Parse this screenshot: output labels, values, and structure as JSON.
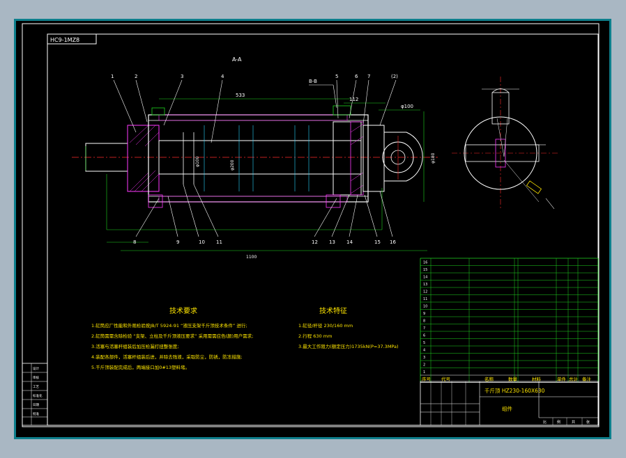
{
  "drawing": {
    "corner_code": "HC9-1MZ8",
    "section_label": "A-A",
    "detail_label": "B-B",
    "part_numbers_top": [
      "1",
      "2",
      "3",
      "4",
      "5",
      "6",
      "7",
      "(2)"
    ],
    "part_numbers_bottom": [
      "8",
      "9",
      "10",
      "11",
      "12",
      "13",
      "14",
      "15",
      "16"
    ],
    "dimensions": {
      "d100": "φ100",
      "d180": "φ180",
      "d112": "112",
      "d533": "533",
      "dia200": "φ200",
      "overall": "1100",
      "d_top": "φ100"
    }
  },
  "tech_requirements": {
    "title": "技术要求",
    "items": [
      "1.缸筒应厂性能和外观检验按JB/T 5924-91 “液压支架千斤顶技术条件” 进行;",
      "2.缸筒需需含除检验 “支架、立柱及千斤顶液压要求” 采用需需应色(颜)用户需求;",
      "3.活塞与活塞杆组装后加压检漏打扭整张度;",
      "4.装配各部件，活塞杆组装后进，并除去残液，采取防尘，防锈，防冻措施;",
      "5.千斤顶装配完成后，两端接口加0#13塑料堵。"
    ]
  },
  "tech_features": {
    "title": "技术特征",
    "items": [
      "1.缸径/杆径  230/160 mm",
      "2.行程        630 mm",
      "3.最大工作阻力(额定压力)1735kN(P=37.3MPa)"
    ]
  },
  "parts_table": {
    "header": [
      "序号",
      "代号",
      "名称",
      "数量",
      "材料",
      "单件",
      "总计",
      "备注"
    ],
    "rows": [
      [
        "16",
        "",
        "",
        "",
        "",
        "",
        "",
        ""
      ],
      [
        "15",
        "",
        "",
        "",
        "",
        "",
        "",
        ""
      ],
      [
        "14",
        "",
        "",
        "",
        "",
        "",
        "",
        ""
      ],
      [
        "13",
        "",
        "",
        "",
        "",
        "",
        "",
        ""
      ],
      [
        "12",
        "",
        "",
        "",
        "",
        "",
        "",
        ""
      ],
      [
        "11",
        "",
        "",
        "",
        "",
        "",
        "",
        ""
      ],
      [
        "10",
        "",
        "",
        "",
        "",
        "",
        "",
        ""
      ],
      [
        "9",
        "",
        "",
        "",
        "",
        "",
        "",
        ""
      ],
      [
        "8",
        "",
        "",
        "",
        "",
        "",
        "",
        ""
      ],
      [
        "7",
        "",
        "",
        "",
        "",
        "",
        "",
        ""
      ],
      [
        "6",
        "",
        "",
        "",
        "",
        "",
        "",
        ""
      ],
      [
        "5",
        "",
        "",
        "",
        "",
        "",
        "",
        ""
      ],
      [
        "4",
        "",
        "",
        "",
        "",
        "",
        "",
        ""
      ],
      [
        "3",
        "",
        "",
        "",
        "",
        "",
        "",
        ""
      ],
      [
        "2",
        "",
        "",
        "",
        "",
        "",
        "",
        ""
      ],
      [
        "1",
        "",
        "",
        "",
        "",
        "",
        "",
        ""
      ]
    ]
  },
  "title_block": {
    "drawing_name": "千斤顶 HZ230-160X630",
    "sub_name": "组件",
    "scale_labels": [
      "比",
      "例",
      "共",
      "张"
    ]
  },
  "left_block": {
    "labels": [
      "设计",
      "审核",
      "工艺",
      "标准化",
      "日期",
      "批准"
    ]
  },
  "colors": {
    "border": "#0e7f8c",
    "line": "#1fd51f",
    "text": "#ffffff",
    "accent": "#ffe600",
    "hatch": "#ff3aff"
  }
}
